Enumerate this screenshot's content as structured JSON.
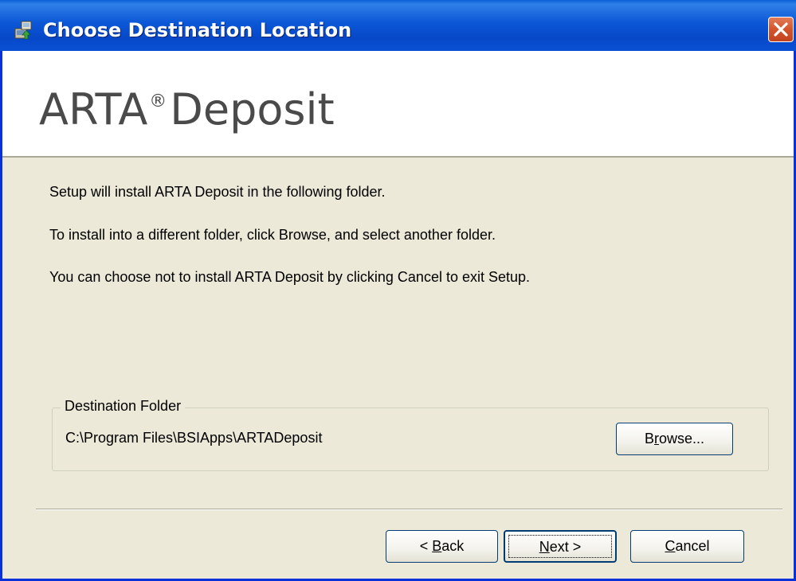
{
  "window": {
    "title": "Choose Destination Location",
    "icon": "installer-icon",
    "close_icon": "close-icon"
  },
  "header": {
    "product_name": "ARTA",
    "registered_mark": "®",
    "product_suffix": "Deposit"
  },
  "messages": [
    "Setup will install ARTA Deposit in the following folder.",
    "To install into a different folder, click Browse, and select another folder.",
    "You can choose not to install ARTA Deposit by clicking Cancel to exit Setup."
  ],
  "destination": {
    "legend": "Destination Folder",
    "path": "C:\\Program Files\\BSIApps\\ARTADeposit",
    "browse_label_pre": "B",
    "browse_label_accel": "r",
    "browse_label_post": "owse..."
  },
  "buttons": {
    "back_pre": "< ",
    "back_accel": "B",
    "back_post": "ack",
    "next_accel": "N",
    "next_post": "ext >",
    "cancel_accel": "C",
    "cancel_post": "ancel"
  },
  "colors": {
    "titlebar": "#0a51d4",
    "dialog_bg": "#ece9d8",
    "close_button": "#d4552b"
  }
}
